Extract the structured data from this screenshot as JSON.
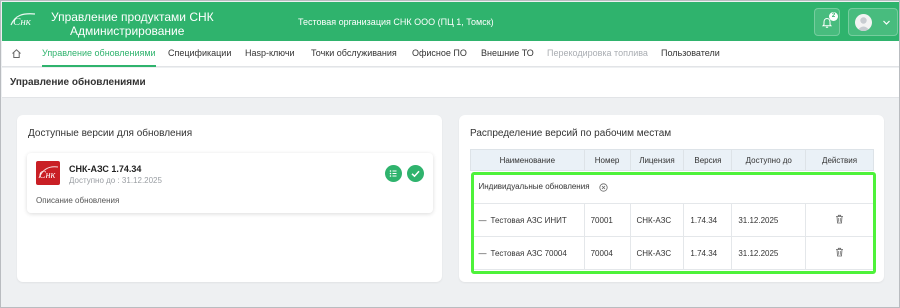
{
  "colors": {
    "brand": "#2fb36d",
    "highlight": "#4ef23a",
    "logo_red": "#c91f25"
  },
  "header": {
    "app_title_line1": "Управление продуктами СНК",
    "app_title_line2": "Администрирование",
    "logo_text": "СНК",
    "organization": "Тестовая организация СНК ООО (ПЦ 1, Томск)",
    "notifications_count": "2",
    "icons": [
      "bell-icon",
      "user-avatar-icon",
      "chevron-down-icon"
    ]
  },
  "nav": {
    "home_icon": "home-icon",
    "items": [
      {
        "label": "Управление обновлениями",
        "state": "active"
      },
      {
        "label": "Спецификации",
        "state": "normal"
      },
      {
        "label": "Hasp-ключи",
        "state": "normal"
      },
      {
        "label": "Точки обслуживания",
        "state": "normal"
      },
      {
        "label": "Офисное ПО",
        "state": "normal"
      },
      {
        "label": "Внешние ТО",
        "state": "normal"
      },
      {
        "label": "Перекодировка топлива",
        "state": "disabled"
      },
      {
        "label": "Пользователи",
        "state": "normal"
      }
    ]
  },
  "page": {
    "title": "Управление обновлениями"
  },
  "available": {
    "title": "Доступные версии для обновления",
    "version": {
      "name": "СНК-АЗС 1.74.34",
      "available_until": "Доступно до : 31.12.2025",
      "description": "Описание обновления",
      "actions": [
        "list-icon",
        "check-icon"
      ]
    }
  },
  "distribution": {
    "title": "Распределение версий по рабочим местам",
    "columns": [
      "Наименование",
      "Номер",
      "Лицензия",
      "Версия",
      "Доступно до",
      "Действия"
    ],
    "group_label": "Индивидуальные обновления",
    "rows": [
      {
        "name": "Тестовая АЗС ИНИТ",
        "number": "70001",
        "license": "СНК-АЗС",
        "version": "1.74.34",
        "until": "31.12.2025"
      },
      {
        "name": "Тестовая АЗС 70004",
        "number": "70004",
        "license": "СНК-АЗС",
        "version": "1.74.34",
        "until": "31.12.2025"
      }
    ]
  }
}
